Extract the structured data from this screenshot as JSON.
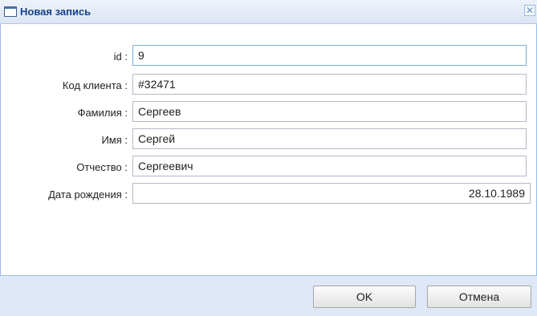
{
  "window": {
    "title": "Новая запись",
    "close_glyph": "✕"
  },
  "form": {
    "fields": [
      {
        "label": "id :",
        "value": "9"
      },
      {
        "label": "Код клиента :",
        "value": "#32471"
      },
      {
        "label": "Фамилия :",
        "value": "Сергеев"
      },
      {
        "label": "Имя :",
        "value": "Сергей"
      },
      {
        "label": "Отчество :",
        "value": "Сергеевич"
      },
      {
        "label": "Дата рождения :",
        "value": "28.10.1989"
      }
    ]
  },
  "buttons": {
    "ok_label": "OK",
    "cancel_label": "Отмена"
  },
  "icons": {
    "window_icon": "window-icon",
    "calendar_icon": "calendar-icon"
  },
  "colors": {
    "title_text": "#15428b",
    "panel_border": "#99bbe8",
    "footer_bg": "#dfe8f6",
    "focus_border": "#7eadd9"
  }
}
